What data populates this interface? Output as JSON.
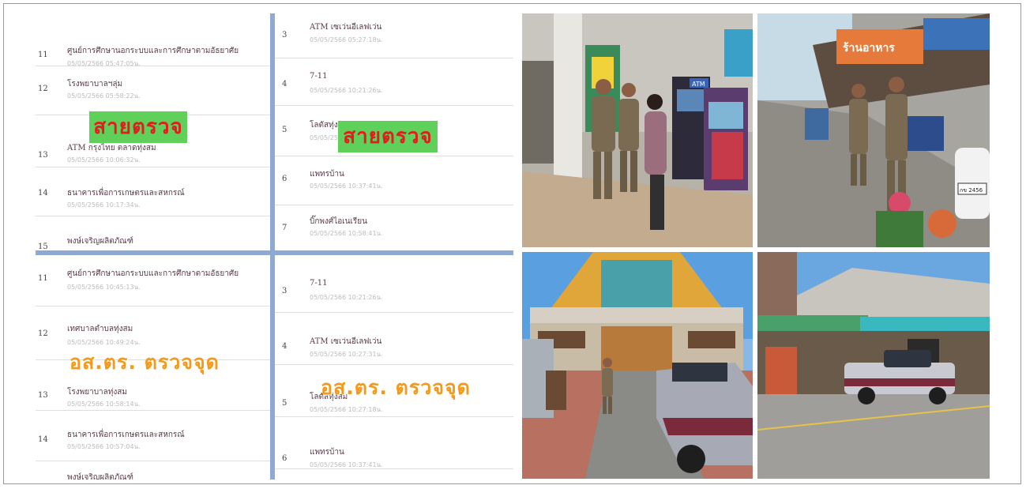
{
  "panel_top_left": {
    "rows": [
      {
        "num": "11",
        "title": "ศูนย์การศึกษานอกระบบและการศึกษาตามอัธยาศัย",
        "ts": "05/05/2566 05:47:05น."
      },
      {
        "num": "12",
        "title": "โรงพยาบาลฯลุ่ม",
        "ts": "05/05/2566 05:58:22น."
      },
      {
        "num": "13",
        "title": "ATM กรุงไทย ตลาดทุ่งสม",
        "ts": "05/05/2566 10:06:32น."
      },
      {
        "num": "14",
        "title": "ธนาคารเพื่อการเกษตรและสหกรณ์",
        "ts": "05/05/2566 10:17:34น."
      },
      {
        "num": "15",
        "title": "พงษ์เจริญผลิตภัณฑ์",
        "ts": ""
      }
    ],
    "tag": "สายตรวจ"
  },
  "panel_top_right": {
    "rows": [
      {
        "num": "3",
        "title": "ATM เซเว่นอีเลฟเว่น",
        "ts": "05/05/2566 05:27:18น."
      },
      {
        "num": "4",
        "title": "7-11",
        "ts": "05/05/2566 10:21:26น."
      },
      {
        "num": "5",
        "title": "โลตัสทุ่งสม",
        "ts": "05/05/2566 10:33:30น."
      },
      {
        "num": "6",
        "title": "แพทรบ้าน",
        "ts": "05/05/2566 10:37:41น."
      },
      {
        "num": "7",
        "title": "บิ๊กพงศ์ไอเนเรียน",
        "ts": "05/05/2566 10:58:41น."
      }
    ],
    "tag": "สายตรวจ"
  },
  "panel_bottom_left": {
    "rows": [
      {
        "num": "11",
        "title": "ศูนย์การศึกษานอกระบบและการศึกษาตามอัธยาศัย",
        "ts": "05/05/2566 10:45:13น."
      },
      {
        "num": "12",
        "title": "เทศบาลตำบลทุ่งสม",
        "ts": "05/05/2566 10:49:24น."
      },
      {
        "num": "13",
        "title": "โรงพยาบาลทุ่งสม",
        "ts": "05/05/2566 10:58:14น."
      },
      {
        "num": "14",
        "title": "ธนาคารเพื่อการเกษตรและสหกรณ์",
        "ts": "05/05/2566 10:57:04น."
      },
      {
        "num": "15",
        "title": "พงษ์เจริญผลิตภัณฑ์",
        "ts": ""
      }
    ],
    "tag": "อส.ตร. ตรวจจุด"
  },
  "panel_bottom_right": {
    "rows": [
      {
        "num": "3",
        "title": "7-11",
        "ts": "05/05/2566 10:21:26น."
      },
      {
        "num": "4",
        "title": "ATM เซเว่นอีเลฟเว่น",
        "ts": "05/05/2566 10:27:31น."
      },
      {
        "num": "5",
        "title": "โลตัสทุ่งสม",
        "ts": "05/05/2566 10:27:18น."
      },
      {
        "num": "6",
        "title": "แพทรบ้าน",
        "ts": "05/05/2566 10:37:41น."
      }
    ],
    "tag": "อส.ตร. ตรวจจุด"
  },
  "photos": {
    "atm_photo": {
      "atm_sign": "ATM"
    },
    "street_photo": {
      "shop_sign": "ร้านอาหาร",
      "plate": "กข 2456"
    },
    "temple_photo": {},
    "truck_photo": {}
  },
  "colors": {
    "separator": "#8faad2",
    "tag_green": "#5fd05a",
    "tag_red": "#e11d1d",
    "tag_orange": "#f39a1e"
  }
}
